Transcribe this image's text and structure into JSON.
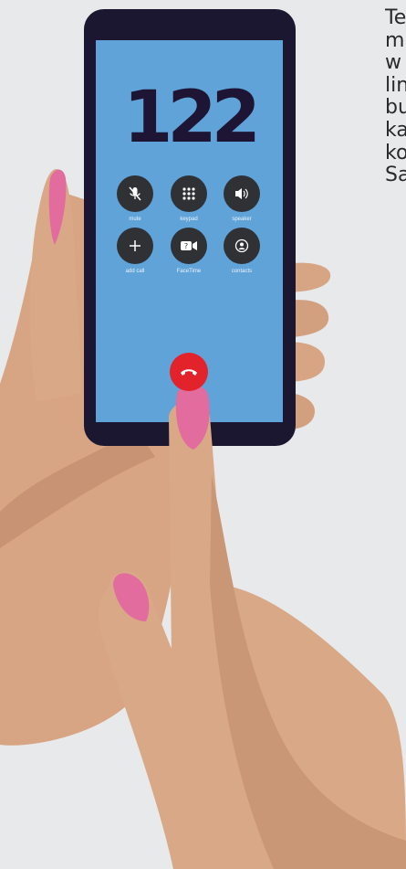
{
  "side_text": [
    "Te",
    "m",
    "w",
    "lin",
    "bu",
    "ka",
    "ko",
    "Sa"
  ],
  "dialer": {
    "number": "122",
    "buttons": [
      {
        "label": "mute",
        "icon": "mute-icon"
      },
      {
        "label": "keypad",
        "icon": "keypad-icon"
      },
      {
        "label": "speaker",
        "icon": "speaker-icon"
      },
      {
        "label": "add call",
        "icon": "add-icon"
      },
      {
        "label": "FaceTime",
        "icon": "facetime-icon"
      },
      {
        "label": "contacts",
        "icon": "contacts-icon"
      }
    ],
    "end_call_icon": "phone-hangup-icon"
  },
  "colors": {
    "background": "#e8e9eb",
    "screen": "#5fa3d9",
    "phone_body": "#1b1730",
    "skin": "#d8a784",
    "nail": "#e36c9e",
    "button": "#2f3135",
    "end_call": "#e3232b"
  }
}
